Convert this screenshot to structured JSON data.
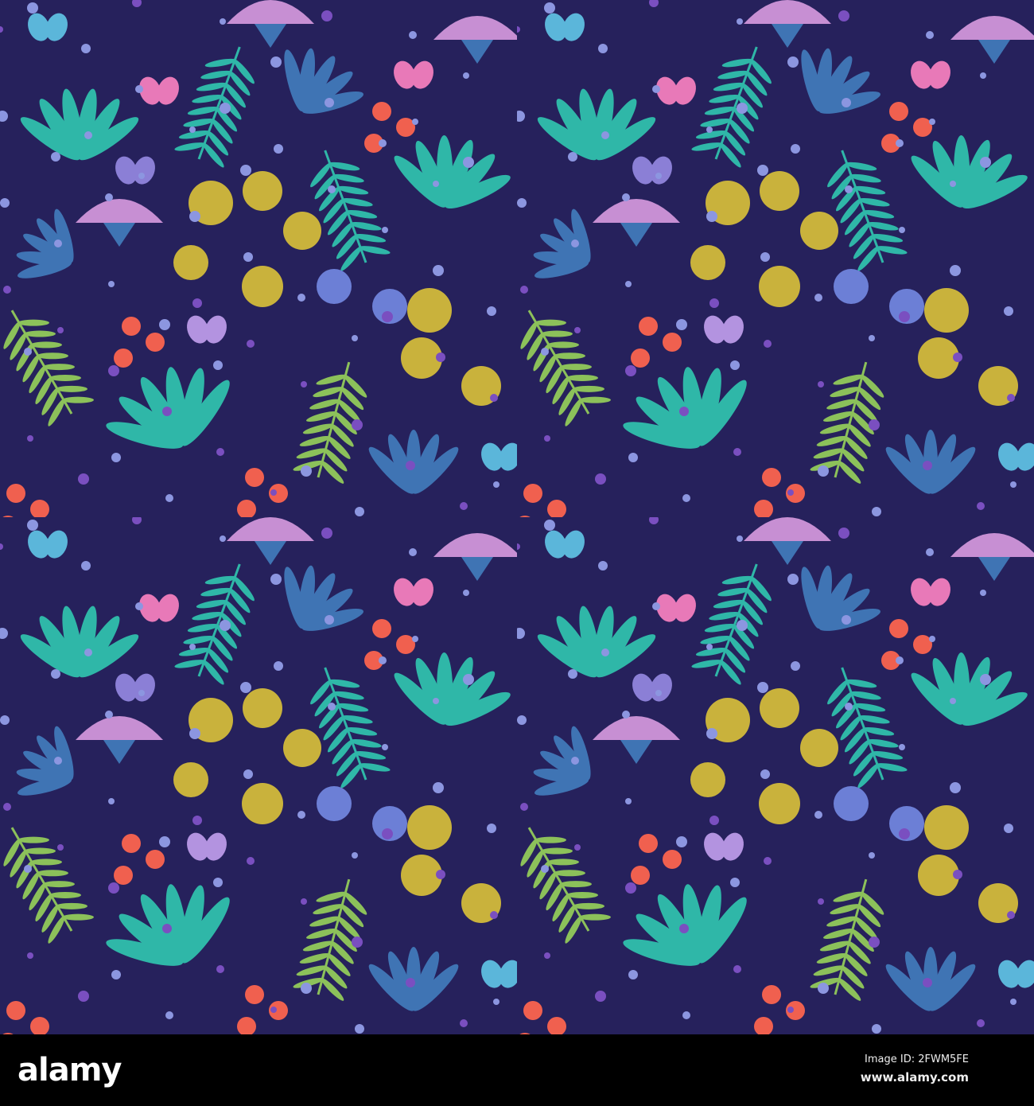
{
  "image": {
    "subject": "seamless floral pattern",
    "colors": {
      "background": "#26215c",
      "teal_leaf": "#2fb7a8",
      "blue_leaf": "#3f74b4",
      "green_leaf": "#8cc15a",
      "yellow_flower": "#c9b23c",
      "pink_flower": "#c78fd3",
      "berry": "#f0604f",
      "butterfly_pink": "#e879b8",
      "butterfly_blue": "#5bb6da",
      "dot": "#8c96e0"
    }
  },
  "footer": {
    "logo": "alamy",
    "image_id": "Image ID: 2FWM5FE",
    "website": "www.alamy.com"
  }
}
